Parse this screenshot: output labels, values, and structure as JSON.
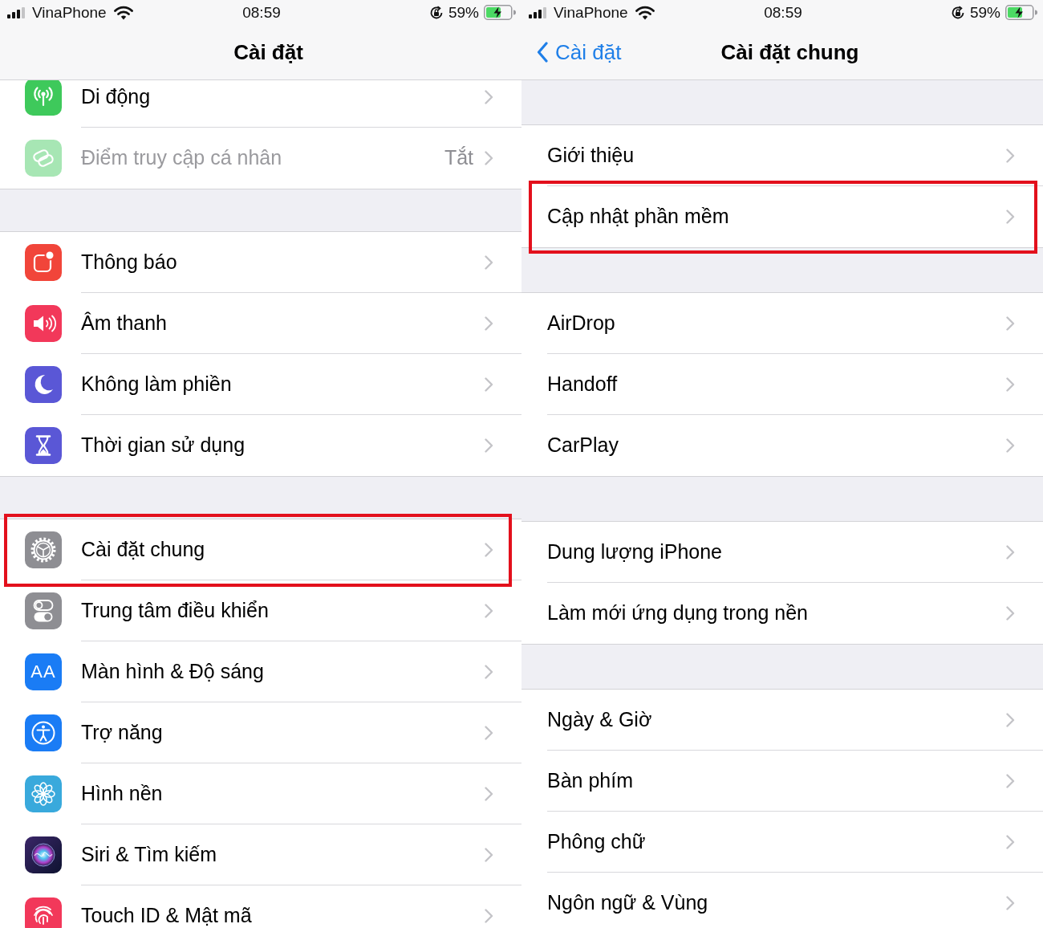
{
  "screens": [
    {
      "kind": "icons",
      "status_bar": {
        "carrier": "VinaPhone",
        "time": "08:59",
        "battery": "59%"
      },
      "nav_bar": {
        "title": "Cài đặt"
      },
      "sections": [
        {
          "rows": [
            {
              "label": "Di động",
              "disabled": false,
              "highlighted": false
            },
            {
              "label": "Điểm truy cập cá nhân",
              "value": "Tắt",
              "disabled": true,
              "highlighted": false
            }
          ]
        },
        {
          "rows": [
            {
              "label": "Thông báo",
              "disabled": false,
              "highlighted": false
            },
            {
              "label": "Âm thanh",
              "disabled": false,
              "highlighted": false
            },
            {
              "label": "Không làm phiền",
              "disabled": false,
              "highlighted": false
            },
            {
              "label": "Thời gian sử dụng",
              "disabled": false,
              "highlighted": false
            }
          ]
        },
        {
          "rows": [
            {
              "label": "Cài đặt chung",
              "disabled": false,
              "highlighted": true
            },
            {
              "label": "Trung tâm điều khiển",
              "disabled": false,
              "highlighted": false
            },
            {
              "label": "Màn hình & Độ sáng",
              "icon_text": "AA",
              "disabled": false,
              "highlighted": false
            },
            {
              "label": "Trợ năng",
              "disabled": false,
              "highlighted": false
            },
            {
              "label": "Hình nền",
              "disabled": false,
              "highlighted": false
            },
            {
              "label": "Siri & Tìm kiếm",
              "disabled": false,
              "highlighted": false
            },
            {
              "label": "Touch ID & Mật mã",
              "disabled": false,
              "highlighted": false
            }
          ]
        }
      ]
    },
    {
      "kind": "plain",
      "status_bar": {
        "carrier": "VinaPhone",
        "time": "08:59",
        "battery": "59%"
      },
      "nav_bar": {
        "back": "Cài đặt",
        "title": "Cài đặt chung"
      },
      "sections": [
        {
          "rows": [
            {
              "label": "Giới thiệu",
              "disabled": false,
              "highlighted": false
            },
            {
              "label": "Cập nhật phần mềm",
              "disabled": false,
              "highlighted": true
            }
          ]
        },
        {
          "rows": [
            {
              "label": "AirDrop",
              "disabled": false,
              "highlighted": false
            },
            {
              "label": "Handoff",
              "disabled": false,
              "highlighted": false
            },
            {
              "label": "CarPlay",
              "disabled": false,
              "highlighted": false
            }
          ]
        },
        {
          "rows": [
            {
              "label": "Dung lượng iPhone",
              "disabled": false,
              "highlighted": false
            },
            {
              "label": "Làm mới ứng dụng trong nền",
              "disabled": false,
              "highlighted": false
            }
          ]
        },
        {
          "rows": [
            {
              "label": "Ngày & Giờ",
              "disabled": false,
              "highlighted": false
            },
            {
              "label": "Bàn phím",
              "disabled": false,
              "highlighted": false
            },
            {
              "label": "Phông chữ",
              "disabled": false,
              "highlighted": false
            },
            {
              "label": "Ngôn ngữ & Vùng",
              "disabled": false,
              "highlighted": false
            }
          ]
        }
      ]
    }
  ]
}
